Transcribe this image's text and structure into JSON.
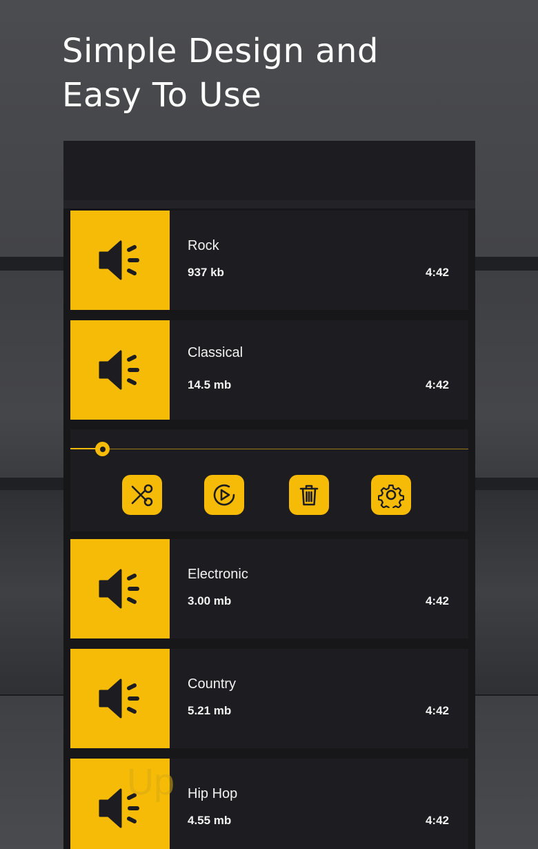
{
  "headline": {
    "line1": "Simple Design and",
    "line2": "Easy To Use"
  },
  "colors": {
    "accent": "#f6bb06",
    "card": "#1d1d21",
    "text": "#f2f2f2"
  },
  "tracks": [
    {
      "name": "Rock",
      "size": "937 kb",
      "duration": "4:42",
      "icon": "speaker-icon"
    },
    {
      "name": "Classical",
      "size": "14.5 mb",
      "duration": "4:42",
      "icon": "speaker-icon"
    },
    {
      "name": "Electronic",
      "size": "3.00 mb",
      "duration": "4:42",
      "icon": "speaker-icon"
    },
    {
      "name": "Country",
      "size": "5.21 mb",
      "duration": "4:42",
      "icon": "speaker-icon"
    },
    {
      "name": "Hip Hop",
      "size": "4.55 mb",
      "duration": "4:42",
      "icon": "speaker-icon"
    }
  ],
  "player": {
    "progress": 0.08,
    "controls": [
      "cut-icon",
      "play-icon",
      "trash-icon",
      "gear-icon"
    ]
  },
  "watermark": "Up"
}
